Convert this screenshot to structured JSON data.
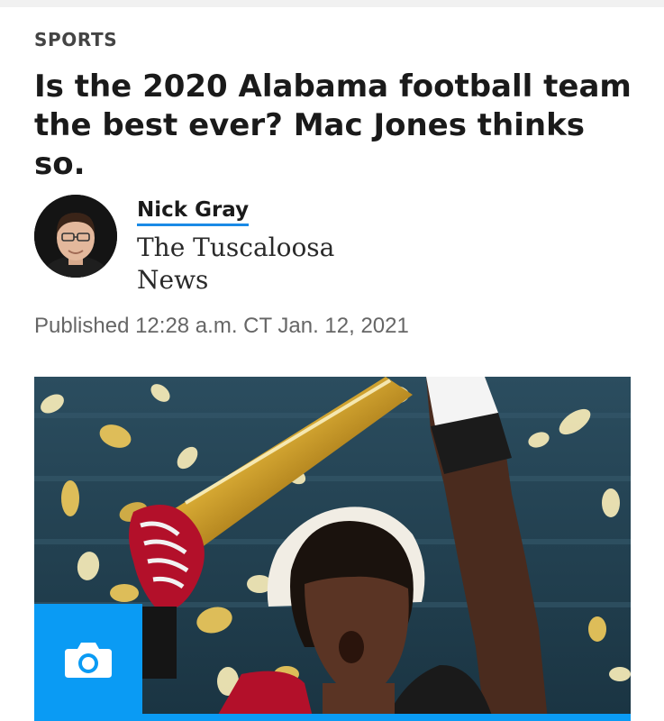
{
  "section": {
    "label": "SPORTS"
  },
  "article": {
    "headline": "Is the 2020 Alabama football team the best ever? Mac Jones thinks so.",
    "published": "Published 12:28 a.m. CT Jan. 12, 2021"
  },
  "author": {
    "name": "Nick Gray",
    "organization": "The Tuscaloosa News"
  },
  "media": {
    "gallery_icon": "camera-icon"
  },
  "colors": {
    "accent": "#0a9bf4",
    "headline": "#1a1a1a",
    "meta": "#666666"
  }
}
